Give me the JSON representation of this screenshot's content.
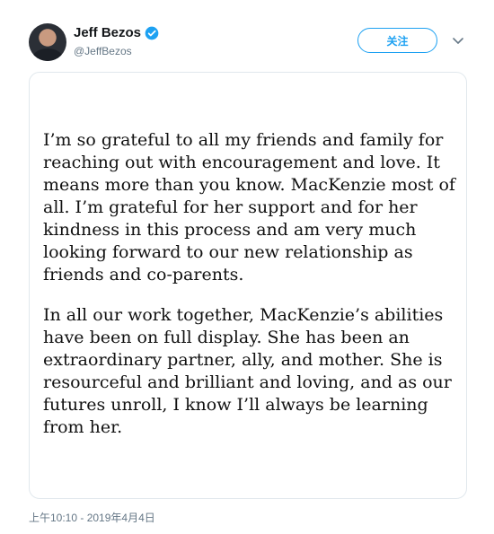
{
  "author": {
    "display_name": "Jeff Bezos",
    "handle": "@JeffBezos",
    "verified": true,
    "avatar_icon": "profile-photo"
  },
  "actions": {
    "follow_label": "关注",
    "more_icon": "chevron-down-icon"
  },
  "tweet": {
    "paragraphs": [
      "I’m so grateful to all my friends and family for reaching out with encouragement and love. It means more than you know. MacKenzie most of all. I’m grateful for her support and for her kindness in this process and am very much looking forward to our new relationship as friends and co-parents.",
      "In all our work together, MacKenzie’s abilities have been on full display. She has been an extraordinary partner, ally, and mother. She is resourceful and brilliant and loving, and as our futures unroll, I know I’ll always be learning from her."
    ],
    "timestamp": "上午10:10 - 2019年4月4日"
  },
  "colors": {
    "accent": "#1da1f2",
    "muted": "#657786",
    "border": "#e1e8ed"
  }
}
